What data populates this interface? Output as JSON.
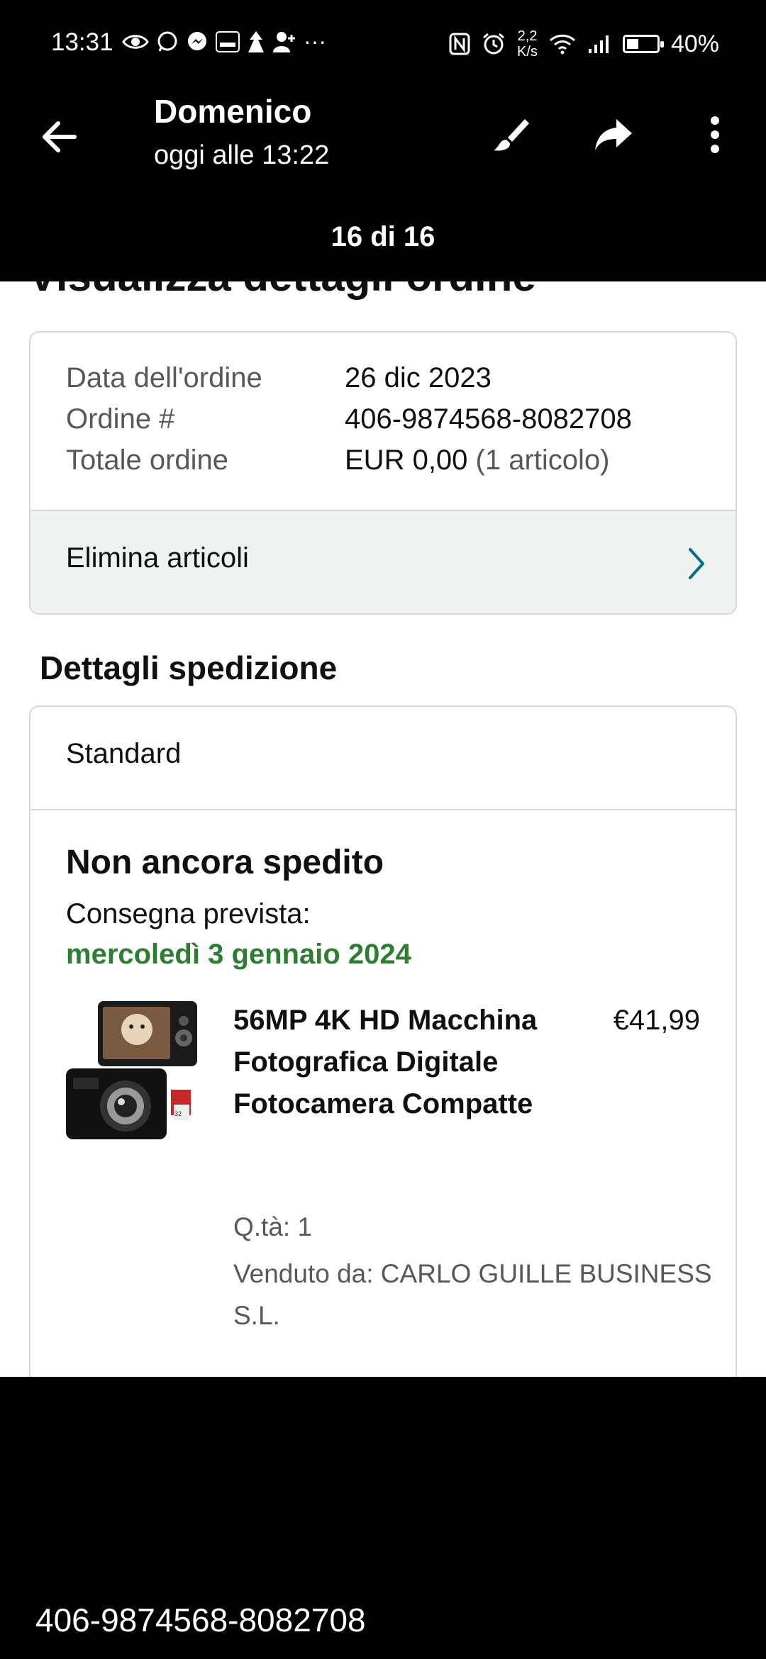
{
  "status_bar": {
    "time": "13:31",
    "left_icons": [
      "eye-icon",
      "whatsapp-icon",
      "messenger-icon",
      "temu-icon",
      "app-icon",
      "contact-add-icon"
    ],
    "more": "···",
    "speed_top": "2,2",
    "speed_bottom": "K/s",
    "battery": "40%",
    "battery_level": 0.4
  },
  "viewer": {
    "sender": "Domenico",
    "time": "oggi alle 13:22",
    "counter": "16 di 16",
    "actions": [
      "edit-brush-icon",
      "share-icon",
      "more-vert-icon"
    ]
  },
  "order": {
    "title": "Visualizza dettagli ordine",
    "date_label": "Data dell'ordine",
    "date_value": "26 dic 2023",
    "number_label": "Ordine #",
    "number_value": "406-9874568-8082708",
    "total_label": "Totale ordine",
    "total_value": "EUR 0,00",
    "total_count": "(1 articolo)",
    "delete_label": "Elimina articoli"
  },
  "shipping": {
    "section_title": "Dettagli spedizione",
    "method": "Standard",
    "status": "Non ancora spedito",
    "delivery_label": "Consegna prevista:",
    "delivery_date": "mercoledì 3 gennaio 2024",
    "product_title": "56MP 4K HD Macchina Fotografica Digitale Fotocamera Compatte",
    "price": "€41,99",
    "quantity": "Q.tà: 1",
    "seller": "Venduto da: CARLO GUILLE BUSINESS S.L."
  },
  "caption": "406-9874568-8082708",
  "colors": {
    "delivery_green": "#2e7d32",
    "chevron_teal": "#007185",
    "card_border": "#d5d9d9"
  }
}
